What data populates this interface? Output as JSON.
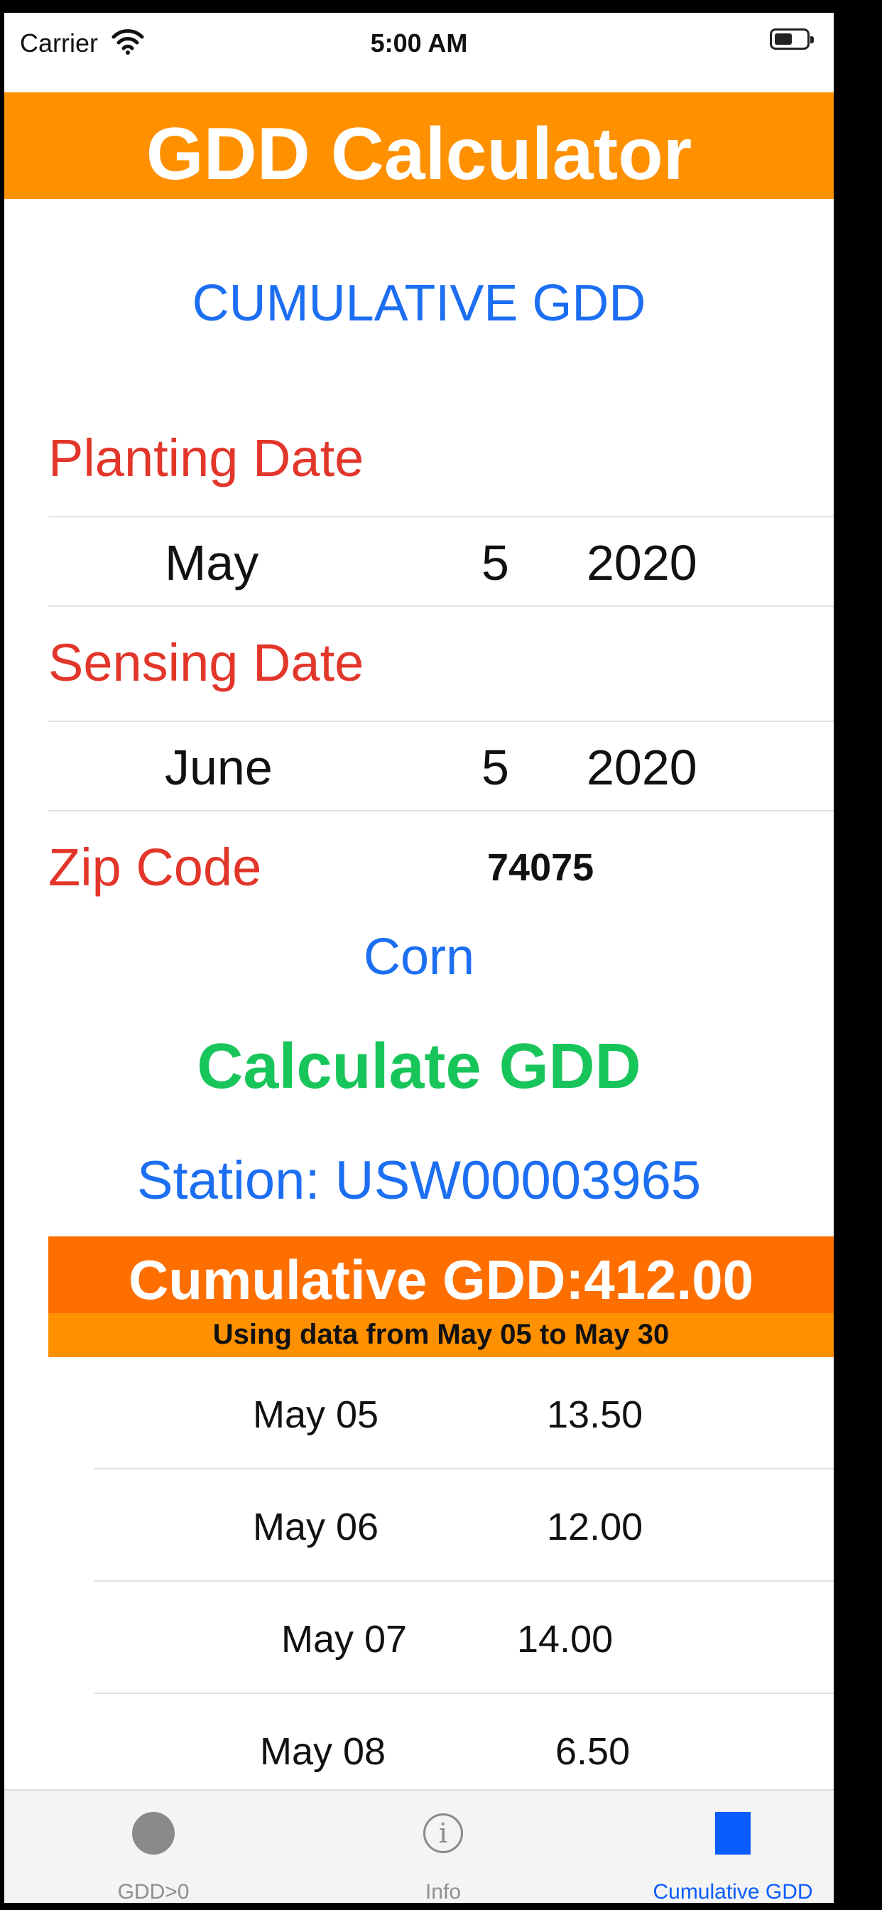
{
  "status_bar": {
    "carrier": "Carrier",
    "time": "5:00 AM"
  },
  "header": {
    "title": "GDD Calculator"
  },
  "section_title": "CUMULATIVE GDD",
  "planting": {
    "label": "Planting Date",
    "month": "May",
    "day": "5",
    "year": "2020"
  },
  "sensing": {
    "label": "Sensing Date",
    "month": "June",
    "day": "5",
    "year": "2020"
  },
  "zip": {
    "label": "Zip Code",
    "value": "74075"
  },
  "crop": "Corn",
  "calculate_label": "Calculate GDD",
  "station": "Station: USW00003965",
  "result": {
    "main": "Cumulative GDD:412.00",
    "sub": "Using data from May 05 to May 30"
  },
  "rows": [
    {
      "date": "May 05",
      "value": "13.50"
    },
    {
      "date": "May 06",
      "value": "12.00"
    },
    {
      "date": "May 07",
      "value": "14.00"
    },
    {
      "date": "May 08",
      "value": "6.50"
    }
  ],
  "tabs": [
    {
      "label": "GDD>0",
      "icon": "circle-icon"
    },
    {
      "label": "Info",
      "icon": "info-icon"
    },
    {
      "label": "Cumulative GDD",
      "icon": "square-icon"
    }
  ],
  "colors": {
    "header": "#ff9100",
    "accent_blue": "#1c6ef2",
    "label_red": "#e2362a",
    "button_green": "#18c55a",
    "result_top": "#ff6f00",
    "active_tab": "#0a5cff"
  }
}
